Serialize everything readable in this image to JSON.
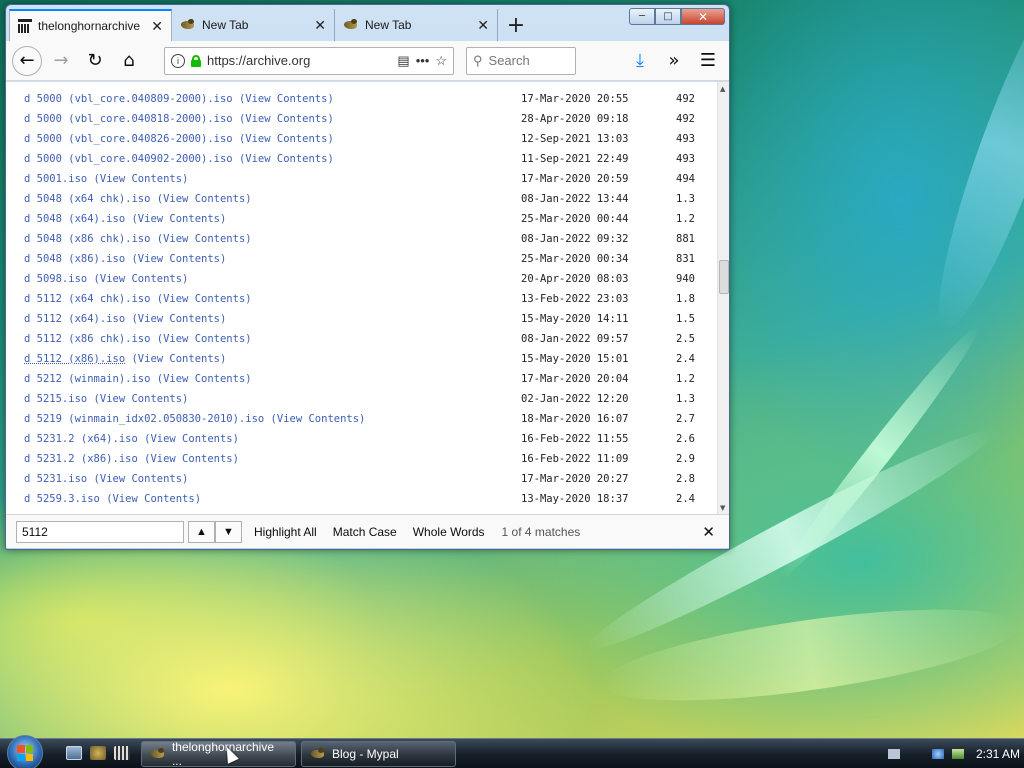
{
  "browser": {
    "tabs": [
      {
        "label": "thelonghornarchive",
        "active": true,
        "icon": "library-icon"
      },
      {
        "label": "New Tab",
        "active": false,
        "icon": "bird-icon"
      },
      {
        "label": "New Tab",
        "active": false,
        "icon": "bird-icon"
      }
    ],
    "new_tab_symbol": "+",
    "url": "https://archive.org",
    "search_placeholder": "Search",
    "page_actions_symbol": "•••"
  },
  "listing": {
    "rows": [
      {
        "prefix": "d ",
        "file": "5000 (vbl_core.040809-2000).iso",
        "link": "(View Contents)",
        "date": "17-Mar-2020 20:55",
        "size": "492"
      },
      {
        "prefix": "d ",
        "file": "5000 (vbl_core.040818-2000).iso",
        "link": "(View Contents)",
        "date": "28-Apr-2020 09:18",
        "size": "492"
      },
      {
        "prefix": "d ",
        "file": "5000 (vbl_core.040826-2000).iso",
        "link": "(View Contents)",
        "date": "12-Sep-2021 13:03",
        "size": "493"
      },
      {
        "prefix": "d ",
        "file": "5000 (vbl_core.040902-2000).iso",
        "link": "(View Contents)",
        "date": "11-Sep-2021 22:49",
        "size": "493"
      },
      {
        "prefix": "d ",
        "file": "5001.iso",
        "link": "(View Contents)",
        "date": "17-Mar-2020 20:59",
        "size": "494"
      },
      {
        "prefix": "d ",
        "file": "5048 (x64 chk).iso",
        "link": "(View Contents)",
        "date": "08-Jan-2022 13:44",
        "size": "1.3"
      },
      {
        "prefix": "d ",
        "file": "5048 (x64).iso",
        "link": "(View Contents)",
        "date": "25-Mar-2020 00:44",
        "size": "1.2"
      },
      {
        "prefix": "d ",
        "file": "5048 (x86 chk).iso",
        "link": "(View Contents)",
        "date": "08-Jan-2022 09:32",
        "size": "881"
      },
      {
        "prefix": "d ",
        "file": "5048 (x86).iso",
        "link": "(View Contents)",
        "date": "25-Mar-2020 00:34",
        "size": "831"
      },
      {
        "prefix": "d ",
        "file": "5098.iso",
        "link": "(View Contents)",
        "date": "20-Apr-2020 08:03",
        "size": "940"
      },
      {
        "prefix": "d ",
        "file": "5112 (x64 chk).iso",
        "link": "(View Contents)",
        "date": "13-Feb-2022 23:03",
        "size": "1.8"
      },
      {
        "prefix": "d ",
        "file": "5112 (x64).iso",
        "link": "(View Contents)",
        "date": "15-May-2020 14:11",
        "size": "1.5"
      },
      {
        "prefix": "d ",
        "file": "5112 (x86 chk).iso",
        "link": "(View Contents)",
        "date": "08-Jan-2022 09:57",
        "size": "2.5"
      },
      {
        "prefix": "d ",
        "file": "5112 (x86).iso",
        "link": "(View Contents)",
        "date": "15-May-2020 15:01",
        "size": "2.4"
      },
      {
        "prefix": "d ",
        "file": "5212 (winmain).iso",
        "link": "(View Contents)",
        "date": "17-Mar-2020 20:04",
        "size": "1.2"
      },
      {
        "prefix": "d ",
        "file": "5215.iso",
        "link": "(View Contents)",
        "date": "02-Jan-2022 12:20",
        "size": "1.3"
      },
      {
        "prefix": "d ",
        "file": "5219 (winmain_idx02.050830-2010).iso",
        "link": "(View Contents)",
        "date": "18-Mar-2020 16:07",
        "size": "2.7"
      },
      {
        "prefix": "d ",
        "file": "5231.2 (x64).iso",
        "link": "(View Contents)",
        "date": "16-Feb-2022 11:55",
        "size": "2.6"
      },
      {
        "prefix": "d ",
        "file": "5231.2 (x86).iso",
        "link": "(View Contents)",
        "date": "16-Feb-2022 11:09",
        "size": "2.9"
      },
      {
        "prefix": "d ",
        "file": "5231.iso",
        "link": "(View Contents)",
        "date": "17-Mar-2020 20:27",
        "size": "2.8"
      },
      {
        "prefix": "d ",
        "file": "5259.3.iso",
        "link": "(View Contents)",
        "date": "13-May-2020 18:37",
        "size": "2.4"
      }
    ]
  },
  "findbar": {
    "query": "5112",
    "highlight_all": "Highlight All",
    "match_case": "Match Case",
    "whole_words": "Whole Words",
    "status": "1 of 4 matches"
  },
  "taskbar": {
    "tasks": [
      {
        "label": "thelonghornarchive ...",
        "active": true
      },
      {
        "label": "Blog - Mypal",
        "active": false
      }
    ],
    "clock": "2:31 AM"
  }
}
